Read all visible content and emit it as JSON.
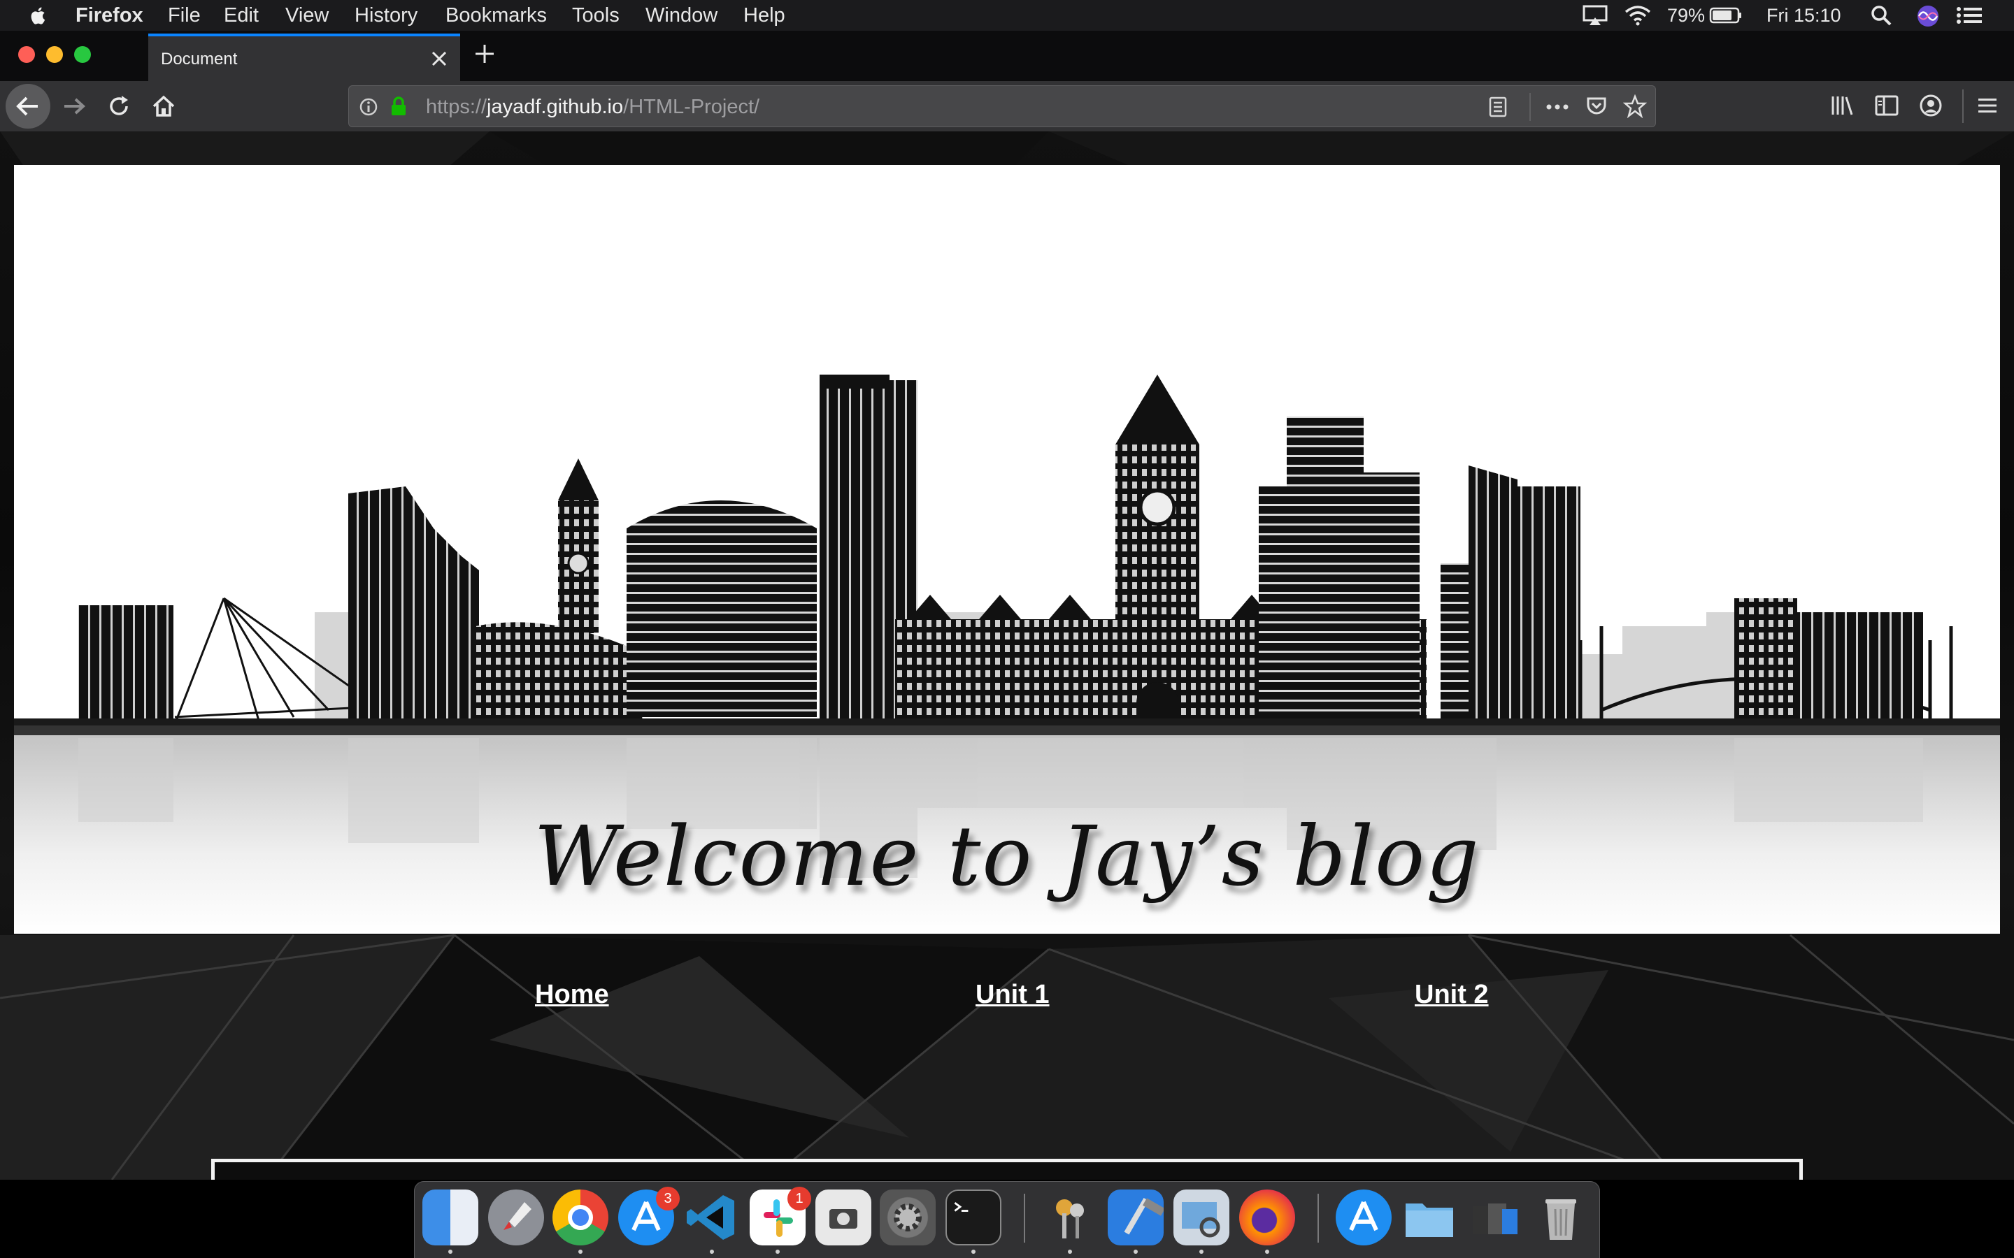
{
  "menubar": {
    "app_name": "Firefox",
    "items": [
      "File",
      "Edit",
      "View",
      "History",
      "Bookmarks",
      "Tools",
      "Window",
      "Help"
    ],
    "battery_percent": "79%",
    "clock": "Fri 15:10"
  },
  "browser": {
    "tab_title": "Document",
    "url_prefix": "https://",
    "url_domain": "jayadf.github.io",
    "url_path": "/HTML-Project/"
  },
  "page": {
    "banner_text": "Welcome to Jay’s blog",
    "nav_links": [
      "Home",
      "Unit 1",
      "Unit 2"
    ]
  },
  "dock": {
    "apps": [
      "Finder",
      "Launchpad",
      "Chrome",
      "App Store",
      "Visual Studio Code",
      "Slack",
      "Screenshot",
      "System Preferences",
      "Terminal",
      "Keychain Access",
      "Xcode",
      "Preview",
      "Firefox",
      "App Store",
      "Documents",
      "Downloads",
      "Trash"
    ],
    "badges": {
      "app_store": "3",
      "slack": "1"
    }
  },
  "colors": {
    "menubar_bg": "#1b1b1d",
    "tabstrip_bg": "#0c0c0d",
    "toolbar_bg": "#323234",
    "tab_accent": "#0a84ff",
    "lock_green": "#12bc00",
    "traffic_close": "#fe5f57",
    "traffic_min": "#febc2e",
    "traffic_max": "#28c840"
  }
}
